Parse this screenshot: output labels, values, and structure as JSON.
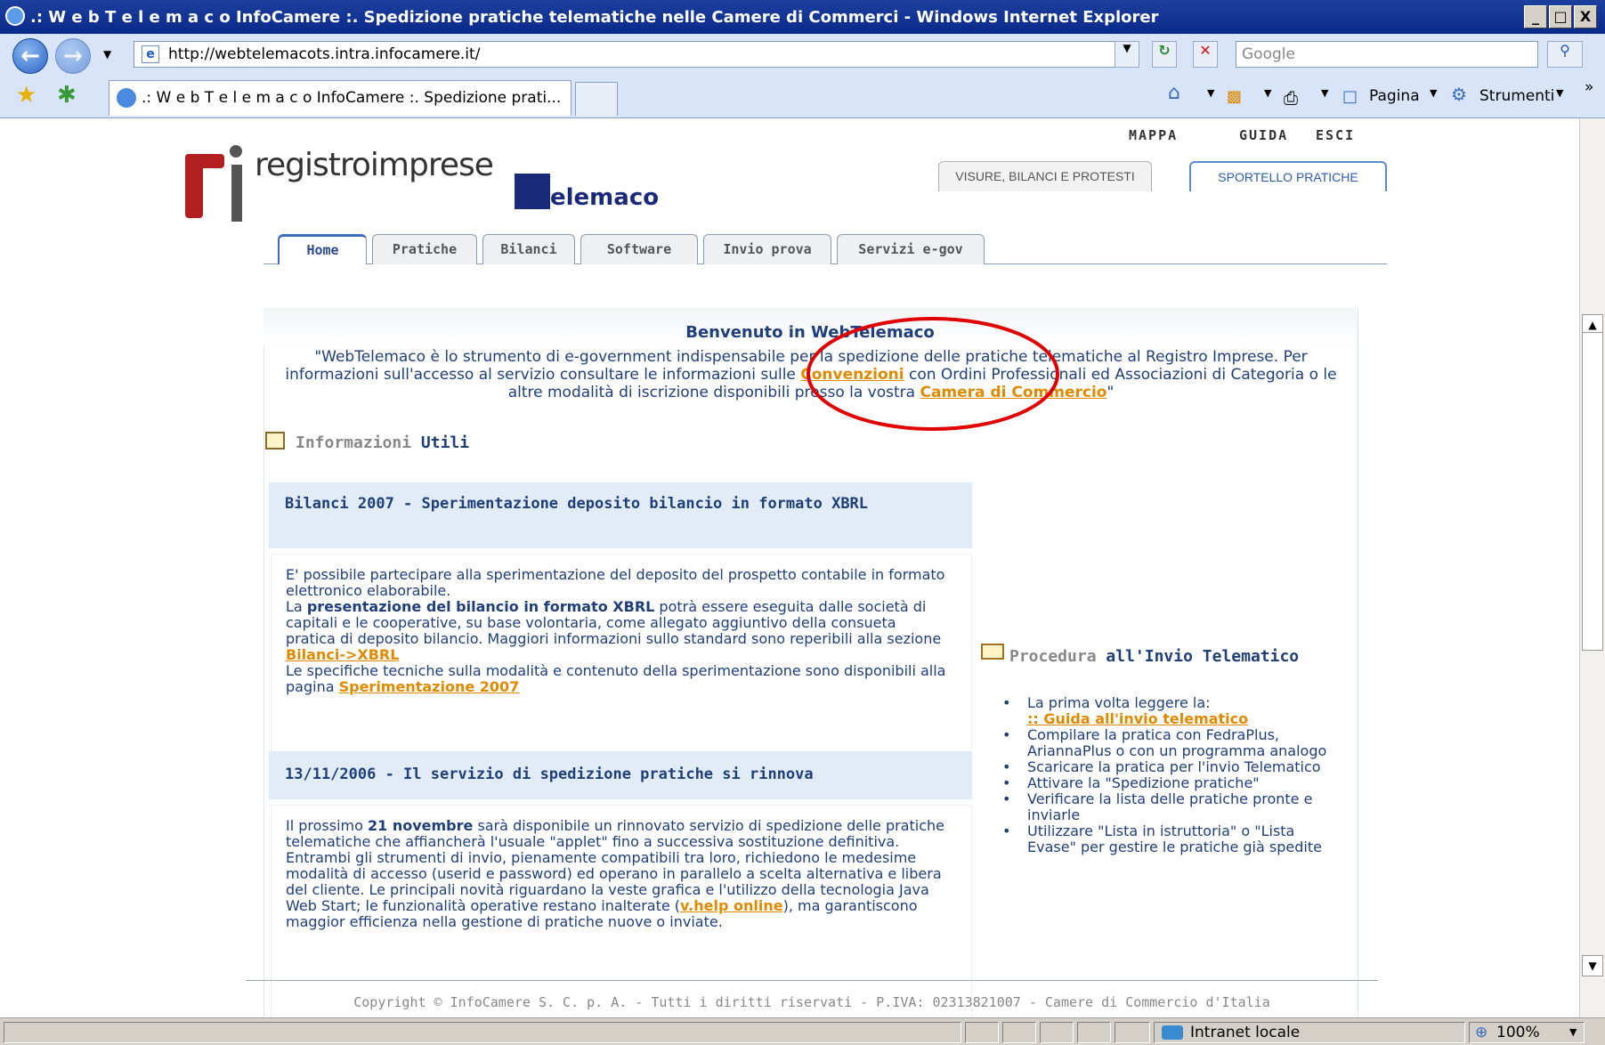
{
  "browser": {
    "window_title": ".: W e b T e l e m a c o InfoCamere :. Spedizione pratiche telematiche nelle Camere di Commerci - Windows Internet Explorer",
    "address": "http://webtelemacots.intra.infocamere.it/",
    "search_placeholder": "Google",
    "tab_title": ".: W e b T e l e m a c o InfoCamere :. Spedizione prati...",
    "cmd_page": "Pagina",
    "cmd_tools": "Strumenti",
    "status_zone": "Intranet locale",
    "zoom": "100%",
    "win_min": "_",
    "win_max": "□",
    "win_close": "X"
  },
  "site": {
    "top_links": [
      "MAPPA",
      "GUIDA",
      "ESCI"
    ],
    "logo_text": "registroimprese",
    "logo2_text": "elemaco",
    "section_tabs": [
      "VISURE, BILANCI E PROTESTI",
      "SPORTELLO PRATICHE"
    ],
    "nav_tabs": [
      "Home",
      "Pratiche",
      "Bilanci",
      "Software",
      "Invio prova",
      "Servizi e-gov"
    ]
  },
  "welcome": {
    "title": "Benvenuto in WebTelemaco",
    "text_1": "\"WebTelemaco è lo strumento di e-government indispensabile per la spedizione delle pratiche telematiche al Registro Imprese. Per informazioni sull'accesso al servizio consultare le informazioni sulle ",
    "link_1": "Convenzioni",
    "text_2": " con Ordini Professionali ed Associazioni di Categoria o le altre modalità di iscrizione disponibili presso la vostra ",
    "link_2": "Camera di Commercio",
    "text_3": "\""
  },
  "info_heading": {
    "grey": "Informazioni",
    "blue": "Utili"
  },
  "news": [
    {
      "title": "Bilanci 2007 - Sperimentazione deposito bilancio in formato XBRL",
      "t1": "E' possibile partecipare alla sperimentazione del deposito del prospetto contabile in formato elettronico elaborabile.",
      "t2a": "La ",
      "t2b": "presentazione del bilancio in formato XBRL",
      "t2c": " potrà essere eseguita dalle società di capitali e le cooperative, su base volontaria, come allegato aggiuntivo della consueta pratica di deposito bilancio. Maggiori informazioni sullo standard sono reperibili alla sezione ",
      "t2link": "Bilanci->XBRL",
      "t3": "Le specifiche tecniche sulla modalità e contenuto della sperimentazione sono disponibili alla pagina ",
      "t3link": "Sperimentazione 2007"
    },
    {
      "title": "13/11/2006 - Il servizio di spedizione pratiche si rinnova",
      "t1a": "Il prossimo ",
      "t1b": "21 novembre",
      "t1c": " sarà disponibile un rinnovato servizio di spedizione delle pratiche telematiche che affiancherà l'usuale \"applet\" fino a successiva sostituzione definitiva. Entrambi gli strumenti di invio, pienamente compatibili tra loro, richiedono le medesime modalità di accesso (userid e password) ed operano in parallelo a scelta alternativa e libera del cliente. Le principali novità riguardano la veste grafica e l'utilizzo della tecnologia Java Web Start; le funzionalità operative restano inalterate (",
      "t1link": "v.help online",
      "t1d": "), ma garantiscono maggior efficienza nella gestione di pratiche nuove o inviate."
    }
  ],
  "procedure": {
    "heading_grey": "Procedura",
    "heading_blue": "all'Invio Telematico",
    "items": [
      "La prima volta leggere la:",
      "Compilare la pratica con FedraPlus, AriannaPlus o con un programma analogo",
      "Scaricare la pratica per l'invio Telematico",
      "Attivare la \"Spedizione pratiche\"",
      "Verificare la lista delle pratiche pronte e inviarle",
      "Utilizzare \"Lista in istruttoria\" o \"Lista Evase\" per gestire le pratiche già spedite"
    ],
    "guide_link": ":: Guida all'invio telematico"
  },
  "footer": "Copyright © InfoCamere S. C. p. A. - Tutti i diritti riservati - P.IVA: 02313821007 - Camere di Commercio d'Italia",
  "colors": {
    "annotation_circle": "#e00000",
    "link": "#e08a00",
    "text_blue": "#1f3f7a"
  }
}
